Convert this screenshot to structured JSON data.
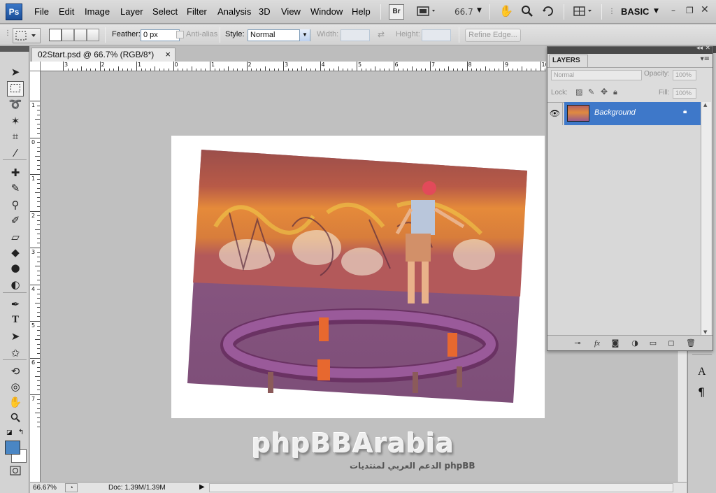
{
  "app": {
    "logo_text": "Ps",
    "workspace": "BASIC",
    "zoom_display": "66.7",
    "bridge_label": "Br"
  },
  "menu": [
    "File",
    "Edit",
    "Image",
    "Layer",
    "Select",
    "Filter",
    "Analysis",
    "3D",
    "View",
    "Window",
    "Help"
  ],
  "options": {
    "feather_label": "Feather:",
    "feather_value": "0 px",
    "antialias_label": "Anti-alias",
    "style_label": "Style:",
    "style_value": "Normal",
    "width_label": "Width:",
    "height_label": "Height:",
    "refine_edge_label": "Refine Edge..."
  },
  "document": {
    "tab_title": "02Start.psd @ 66.7% (RGB/8*)",
    "close_glyph": "×",
    "ruler_top_labels": [
      "3",
      "2",
      "1",
      "0",
      "1",
      "2",
      "3",
      "4",
      "5",
      "6",
      "7",
      "8",
      "9",
      "10"
    ],
    "ruler_left_labels": [
      "1",
      "0",
      "1",
      "2",
      "3",
      "4",
      "5",
      "6",
      "7"
    ]
  },
  "status": {
    "zoom": "66.67%",
    "doc_info": "Doc: 1.39M/1.39M"
  },
  "layers_panel": {
    "title": "LAYERS",
    "blend_mode": "Normal",
    "opacity_label": "Opacity:",
    "opacity_value": "100%",
    "lock_label": "Lock:",
    "fill_label": "Fill:",
    "fill_value": "100%",
    "layer_name": "Background"
  },
  "watermark": {
    "main": "phpBBArabia",
    "sub": "الدعم العربي لمنتديات phpBB"
  },
  "colors": {
    "foreground": "#4a86c4",
    "background": "#ffffff",
    "selection": "#3e78c9",
    "accent": "#1b4d97"
  }
}
